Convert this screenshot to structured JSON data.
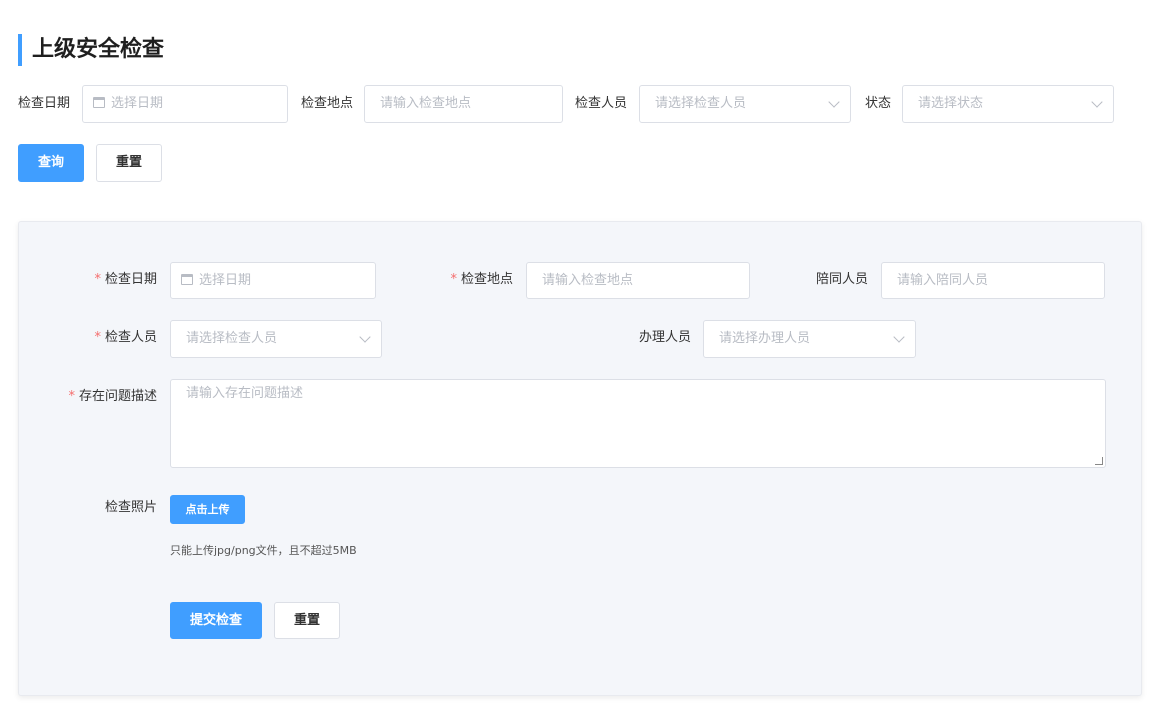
{
  "page": {
    "title": "上级安全检查"
  },
  "filter": {
    "date_label": "检查日期",
    "date_placeholder": "选择日期",
    "location_label": "检查地点",
    "location_placeholder": "请输入检查地点",
    "inspector_label": "检查人员",
    "inspector_placeholder": "请选择检查人员",
    "status_label": "状态",
    "status_placeholder": "请选择状态",
    "query_button": "查询",
    "reset_button": "重置"
  },
  "form": {
    "required_mark": "*",
    "date_label": "检查日期",
    "date_placeholder": "选择日期",
    "location_label": "检查地点",
    "location_placeholder": "请输入检查地点",
    "companion_label": "陪同人员",
    "companion_placeholder": "请输入陪同人员",
    "inspector_label": "检查人员",
    "inspector_placeholder": "请选择检查人员",
    "handler_label": "办理人员",
    "handler_placeholder": "请选择办理人员",
    "problem_label": "存在问题描述",
    "problem_placeholder": "请输入存在问题描述",
    "photo_label": "检查照片",
    "upload_button": "点击上传",
    "upload_tip": "只能上传jpg/png文件，且不超过5MB",
    "submit_button": "提交检查",
    "reset_button": "重置"
  },
  "icons": {
    "calendar": "calendar-icon",
    "dropdown": "chevron-down-icon"
  },
  "colors": {
    "accent": "#409eff",
    "required": "#f56c6c",
    "panel_bg": "#f4f6fa"
  }
}
